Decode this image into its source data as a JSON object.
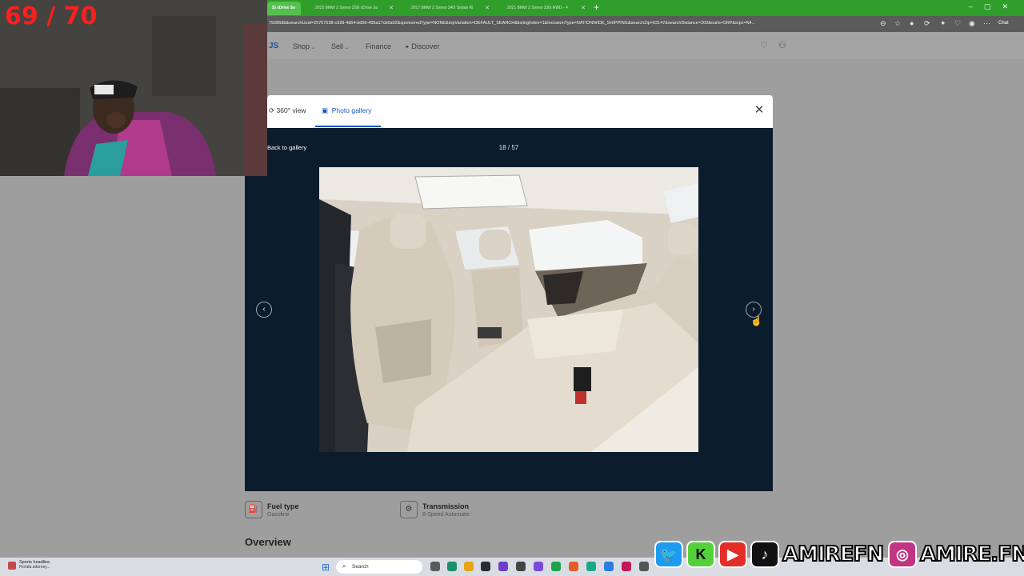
{
  "browser": {
    "tabs": [
      {
        "label": "Si xDrive Se",
        "active": true
      },
      {
        "label": "2015 BMW 2 Series 228i xDrive Su",
        "active": false
      },
      {
        "label": "2017 BMW 3 Series 340i Sedan Rl",
        "active": false
      },
      {
        "label": "2021 BMW 3 Series 330i RWD - 4",
        "active": false
      }
    ],
    "new_tab": "+",
    "url": "79286db&searchUuid=29707538-c928-4d64-bd50-405a17cb0a02&sponsoredType=NONE&srpVariation=DEFAULT_SEARCH&listingIndex=1&inclusionType=NATIONWIDE_SHIPPING&searchZip=63147&searchDistance=200&ourls=SRP&srpc=N4...",
    "chat_label": "Chat"
  },
  "site_header": {
    "logo": "JS",
    "nav": [
      {
        "label": "Shop",
        "has_dropdown": true
      },
      {
        "label": "Sell",
        "has_dropdown": true
      },
      {
        "label": "Finance",
        "has_dropdown": false
      },
      {
        "label": "Discover",
        "has_dropdown": false
      }
    ]
  },
  "modal": {
    "tabs": {
      "view360": "360° view",
      "gallery": "Photo gallery"
    },
    "back_link": "Back to gallery",
    "counter": "18 / 57",
    "close_icon": "close-icon",
    "prev_icon": "chevron-left-icon",
    "next_icon": "chevron-right-icon"
  },
  "specs": [
    {
      "label": "Fuel type",
      "value": "Gasoline"
    },
    {
      "label": "Transmission",
      "value": "8-Speed Automatic"
    }
  ],
  "section_title": "Overview",
  "overlay_counter": "69 / 70",
  "taskbar": {
    "news_title": "Sports headline",
    "news_sub": "Florida attorney...",
    "search_label": "Search"
  },
  "social": {
    "handle1": "AMIREFN",
    "handle2": "AMIRE.FN"
  },
  "colors": {
    "brand_blue": "#1a55c2",
    "modal_dark": "#0b1c2c",
    "tabbar_green": "#2f9e2a"
  }
}
